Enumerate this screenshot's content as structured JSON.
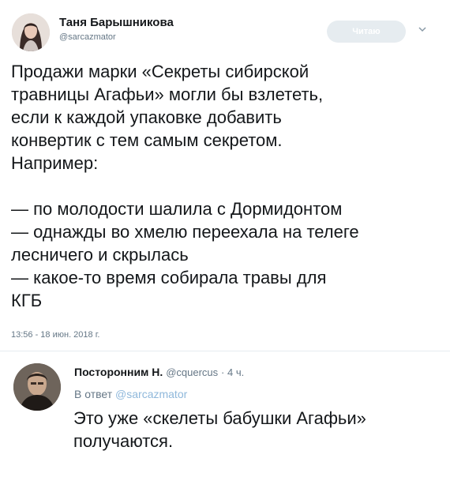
{
  "tweet": {
    "author_name": "Таня Барышникова",
    "author_handle": "@sarcazmator",
    "follow_label": "Читаю",
    "text_lines": [
      "Продажи марки «Секреты сибирской",
      "травницы Агафьи» могли бы взлететь,",
      "если к каждой упаковке добавить",
      "конвертик с тем самым секретом.",
      "Например:"
    ],
    "list_lines": [
      "— по молодости шалила с Дормидонтом",
      "— однажды во хмелю переехала на телеге",
      "лесничего и скрылась",
      "— какое-то время собирала травы для",
      "КГБ"
    ],
    "timestamp": "13:56 - 18 июн. 2018 г."
  },
  "reply": {
    "author_name": "Посторонним Н.",
    "author_handle": "@cquercus",
    "time": "· 4 ч.",
    "reply_to_prefix": "В ответ",
    "reply_to_handle": "@sarcazmator",
    "text_lines": [
      "Это уже «скелеты бабушки Агафьи»",
      "получаются."
    ]
  },
  "icons": {
    "caret": "chevron-down-icon",
    "avatar_main": "avatar",
    "avatar_reply": "avatar"
  },
  "colors": {
    "text": "#14171a",
    "secondary": "#657786",
    "follow_bg": "#e6ecf0",
    "link": "#8fb8db"
  }
}
